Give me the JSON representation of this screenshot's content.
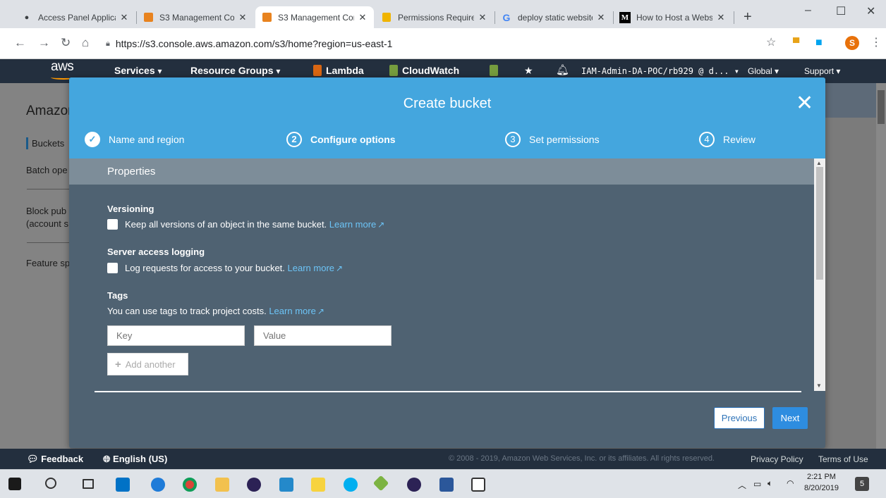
{
  "browser": {
    "tabs": [
      {
        "title": "Access Panel Applica",
        "icon": "globe-icon"
      },
      {
        "title": "S3 Management Con",
        "icon": "aws-cube-icon"
      },
      {
        "title": "S3 Management Con",
        "icon": "aws-cube-icon"
      },
      {
        "title": "Permissions Require",
        "icon": "aws-doc-icon"
      },
      {
        "title": "deploy static website",
        "icon": "google-icon"
      },
      {
        "title": "How to Host a Webs",
        "icon": "medium-icon"
      }
    ],
    "new_tab": "+",
    "url": "https://s3.console.aws.amazon.com/s3/home?region=us-east-1",
    "profile_initial": "S",
    "window_controls": [
      "–",
      "☐",
      "✕"
    ]
  },
  "aws_header": {
    "logo": "aws",
    "services": "Services",
    "resource_groups": "Resource Groups",
    "lambda": "Lambda",
    "cloudwatch": "CloudWatch",
    "account": "IAM-Admin-DA-POC/rb929 @ d...",
    "region": "Global",
    "support": "Support",
    "caret": "▾"
  },
  "background_page": {
    "brand": "Amazon",
    "items": [
      "Buckets",
      "Batch ope",
      "Block pub",
      "(account s",
      "Feature sp"
    ]
  },
  "modal": {
    "title": "Create bucket",
    "close": "✕",
    "steps": [
      {
        "number": "✓",
        "label": "Name and region",
        "state": "done"
      },
      {
        "number": "2",
        "label": "Configure options",
        "state": "current"
      },
      {
        "number": "3",
        "label": "Set permissions",
        "state": "pending"
      },
      {
        "number": "4",
        "label": "Review",
        "state": "pending"
      }
    ],
    "properties_heading": "Properties",
    "versioning": {
      "title": "Versioning",
      "checkbox_label": "Keep all versions of an object in the same bucket.",
      "link": "Learn more",
      "checked": false
    },
    "logging": {
      "title": "Server access logging",
      "checkbox_label": "Log requests for access to your bucket.",
      "link": "Learn more",
      "checked": false
    },
    "tags": {
      "title": "Tags",
      "description": "You can use tags to track project costs.",
      "link": "Learn more",
      "key_placeholder": "Key",
      "value_placeholder": "Value",
      "add_another": "Add another"
    },
    "buttons": {
      "previous": "Previous",
      "next": "Next"
    }
  },
  "footer": {
    "feedback": "Feedback",
    "language": "English (US)",
    "copyright": "© 2008 - 2019, Amazon Web Services, Inc. or its affiliates. All rights reserved.",
    "privacy": "Privacy Policy",
    "terms": "Terms of Use"
  },
  "taskbar": {
    "time": "2:21 PM",
    "date": "8/20/2019",
    "notifications": "5"
  },
  "colors": {
    "modal_header": "#44a6de",
    "modal_body": "#4f6272",
    "aws_nav": "#232f3e",
    "link": "#6cc4f7",
    "primary_button": "#2e8de0"
  }
}
